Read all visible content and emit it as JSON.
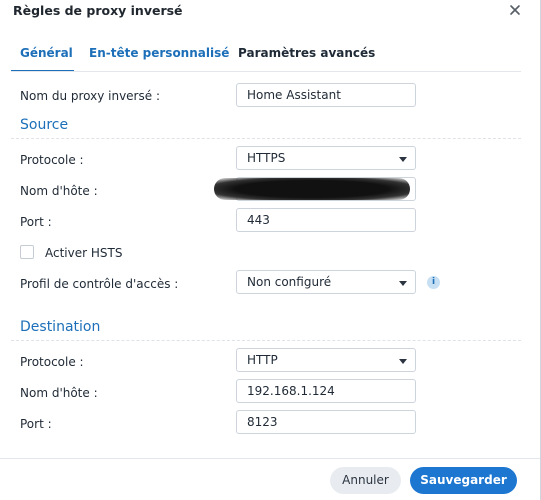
{
  "dialog": {
    "title": "Règles de proxy inversé",
    "close_icon": "close-icon"
  },
  "tabs": [
    {
      "label": "Général",
      "active": true
    },
    {
      "label": "En-tête personnalisé",
      "active": false
    },
    {
      "label": "Paramètres avancés",
      "active": false
    }
  ],
  "general": {
    "name_label": "Nom du proxy inversé :",
    "name_value": "Home Assistant"
  },
  "source": {
    "heading": "Source",
    "protocol_label": "Protocole :",
    "protocol_value": "HTTPS",
    "hostname_label": "Nom d'hôte :",
    "hostname_value": "",
    "port_label": "Port :",
    "port_value": "443",
    "hsts_label": "Activer HSTS",
    "hsts_checked": false,
    "access_label": "Profil de contrôle d'accès :",
    "access_value": "Non configuré",
    "info_icon": "info-icon",
    "info_glyph": "i"
  },
  "destination": {
    "heading": "Destination",
    "protocol_label": "Protocole :",
    "protocol_value": "HTTP",
    "hostname_label": "Nom d'hôte :",
    "hostname_value": "192.168.1.124",
    "port_label": "Port :",
    "port_value": "8123"
  },
  "footer": {
    "cancel_label": "Annuler",
    "save_label": "Sauvegarder"
  },
  "colors": {
    "accent": "#1c6fb8",
    "primary_button": "#1d77d1",
    "secondary_button": "#e8ecf0"
  }
}
